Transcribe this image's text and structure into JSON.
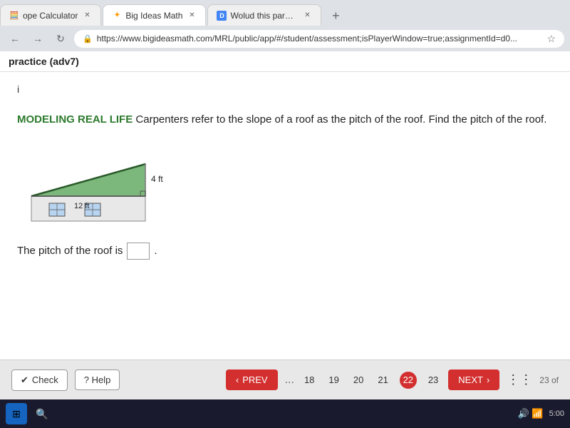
{
  "browser": {
    "tabs": [
      {
        "id": "tab1",
        "label": "ope Calculator",
        "favicon": "calc",
        "active": false
      },
      {
        "id": "tab2",
        "label": "Big Ideas Math",
        "favicon": "bigideas",
        "active": true
      },
      {
        "id": "tab3",
        "label": "Wolud this paragraph be a com:",
        "favicon": "doc",
        "active": false
      }
    ],
    "new_tab_symbol": "+",
    "address": "https://www.bigideasmath.com/MRL/public/app/#/student/assessment;isPlayerWindow=true;assignmentId=d0...",
    "back_label": "←",
    "forward_label": "→",
    "reload_label": "↻"
  },
  "page": {
    "title": "practice (adv7)",
    "question_number": "i",
    "modeling_label": "MODELING REAL LIFE",
    "question_text": " Carpenters refer to the slope of a roof as the pitch of the roof. Find the pitch of the roof.",
    "diagram": {
      "rise_label": "4 ft",
      "run_label": "12 ft"
    },
    "answer_prefix": "The pitch of the roof is",
    "answer_suffix": "."
  },
  "nav": {
    "check_label": "Check",
    "help_label": "? Help",
    "prev_label": "PREV",
    "next_label": "NEXT",
    "ellipsis": "...",
    "pages": [
      {
        "num": "18",
        "current": false
      },
      {
        "num": "19",
        "current": false
      },
      {
        "num": "20",
        "current": false
      },
      {
        "num": "21",
        "current": false
      },
      {
        "num": "22",
        "current": true
      },
      {
        "num": "23",
        "current": false
      }
    ],
    "page_indicator": "23 of",
    "check_icon": "✔"
  },
  "taskbar": {
    "time": "5:00"
  }
}
